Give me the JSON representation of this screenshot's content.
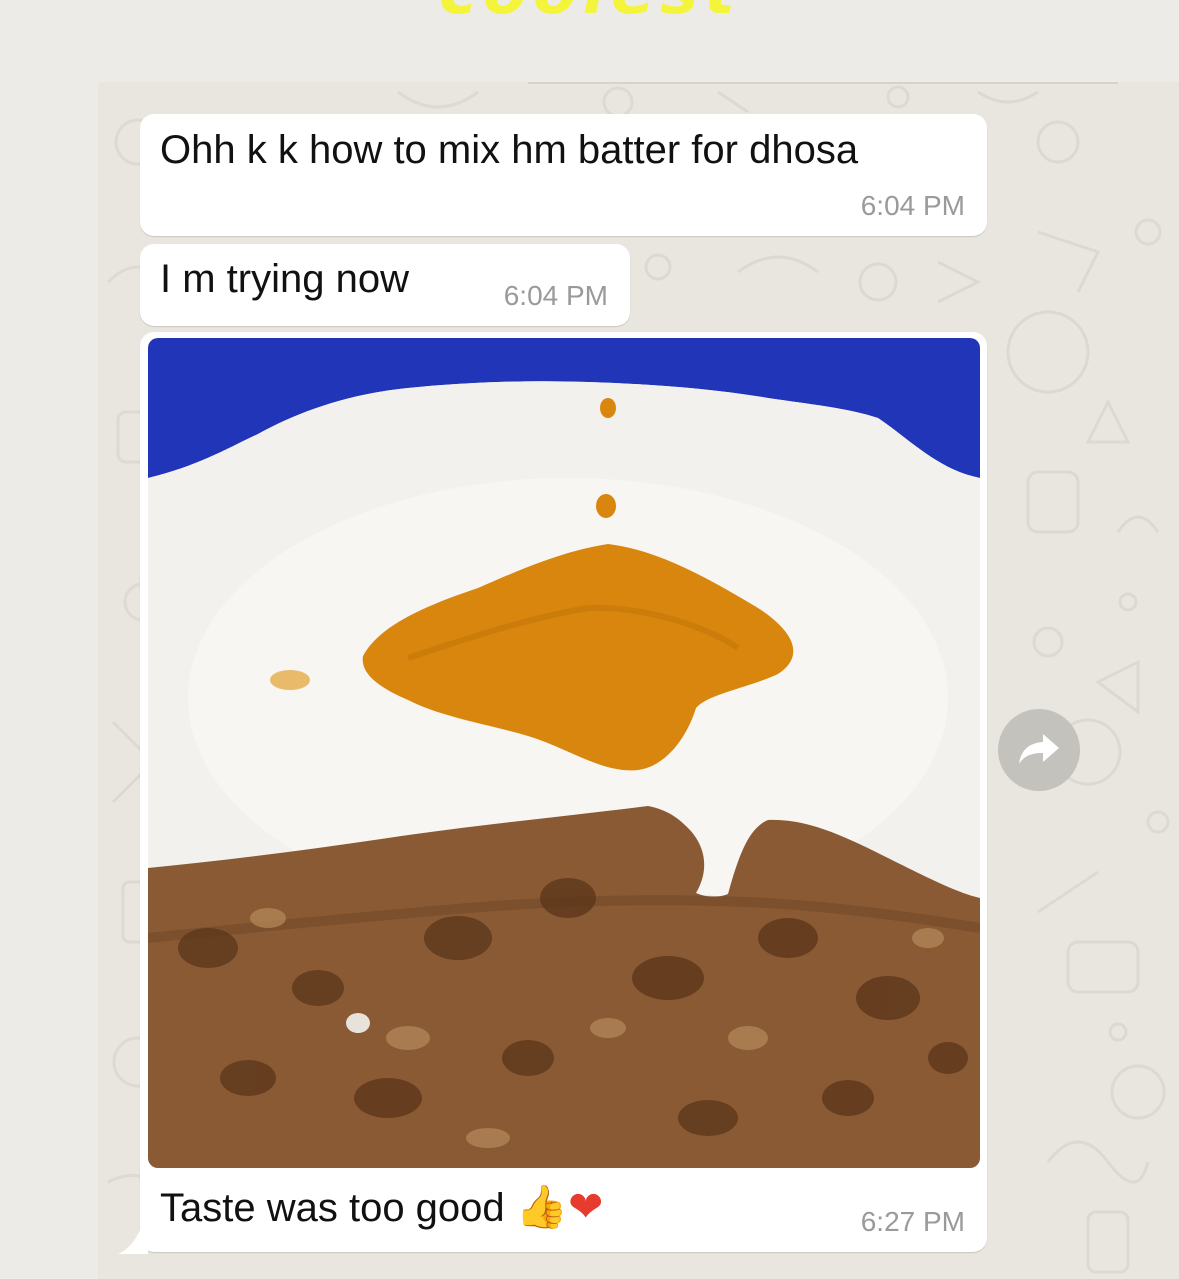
{
  "header": {
    "overlay_title": "coolest bits"
  },
  "messages": [
    {
      "text": "Ohh k k how to mix hm batter for dhosa",
      "time": "6:04 PM"
    },
    {
      "text": "I m trying now",
      "time": "6:04 PM"
    },
    {
      "image": "photo of dosa with chutney on a white plate",
      "caption": "Taste was too good",
      "emojis": [
        "thumbs-up",
        "heart"
      ],
      "time": "6:27 PM"
    }
  ],
  "icons": {
    "forward": "forward-arrow-icon",
    "thumb": "thumbs-up-emoji",
    "heart": "red-heart-emoji"
  },
  "colors": {
    "wallpaper": "#e9e6df",
    "bubble": "#ffffff",
    "timestamp": "#9a9a9a",
    "plate_rim": "#2135b8",
    "chutney": "#d9860e",
    "dosa": "#8a5a34",
    "overlay_title": "#f4f53a"
  }
}
